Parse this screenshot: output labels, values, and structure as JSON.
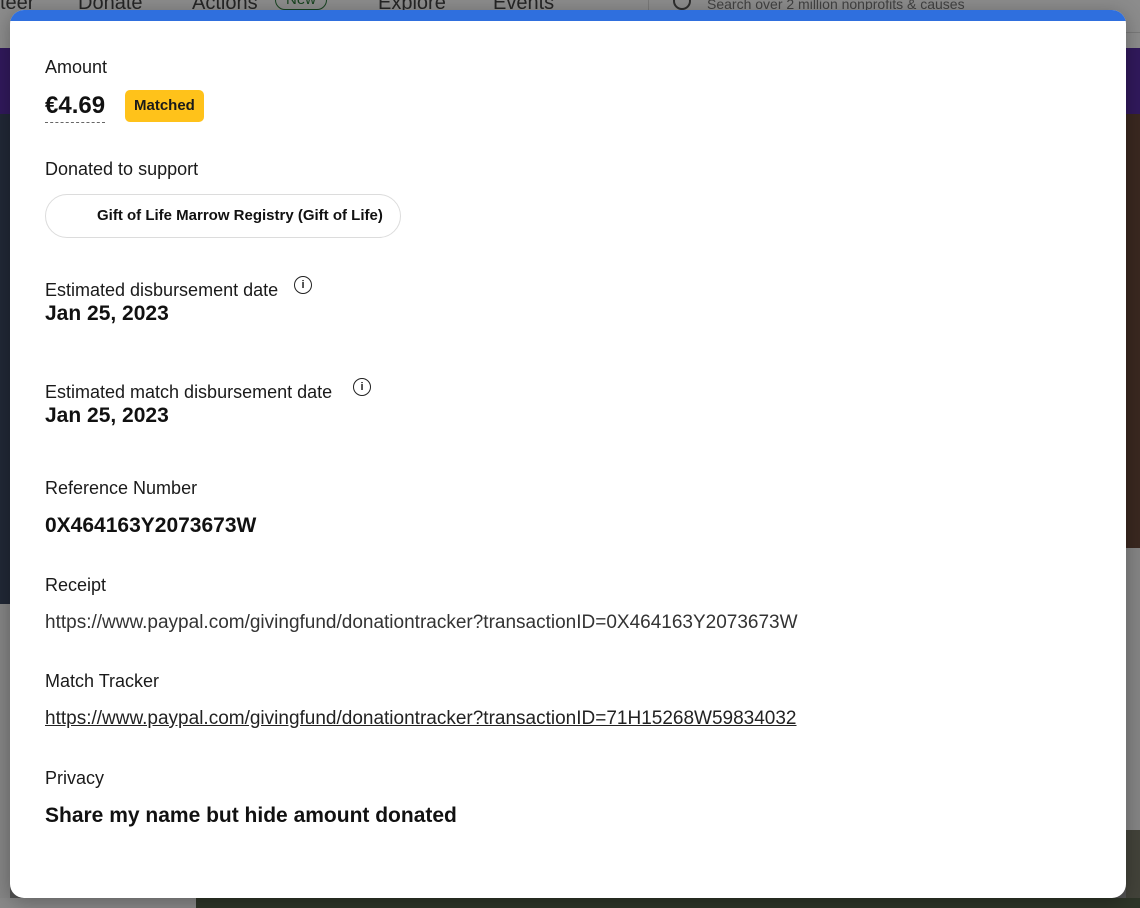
{
  "background": {
    "nav": [
      "teer",
      "Donate",
      "Actions",
      "Explore",
      "Events"
    ],
    "new_badge": "New",
    "search_placeholder": "Search over 2 million nonprofits & causes"
  },
  "modal": {
    "amount_label": "Amount",
    "amount_value": "€4.69",
    "matched_badge": "Matched",
    "donated_to_label": "Donated to support",
    "organization": "Gift of Life Marrow Registry (Gift of Life)",
    "disbursement_label": "Estimated disbursement date",
    "disbursement_date": "Jan 25, 2023",
    "match_disbursement_label": "Estimated match disbursement date",
    "match_disbursement_date": "Jan 25, 2023",
    "reference_label": "Reference Number",
    "reference_number": "0X464163Y2073673W",
    "receipt_label": "Receipt",
    "receipt_url": "https://www.paypal.com/givingfund/donationtracker?transactionID=0X464163Y2073673W",
    "match_tracker_label": "Match Tracker",
    "match_tracker_url": "https://www.paypal.com/givingfund/donationtracker?transactionID=71H15268W59834032",
    "privacy_label": "Privacy",
    "privacy_value": "Share my name but hide amount donated"
  },
  "colors": {
    "top_bar": "#2f6fde",
    "matched_badge": "#ffc21a"
  }
}
